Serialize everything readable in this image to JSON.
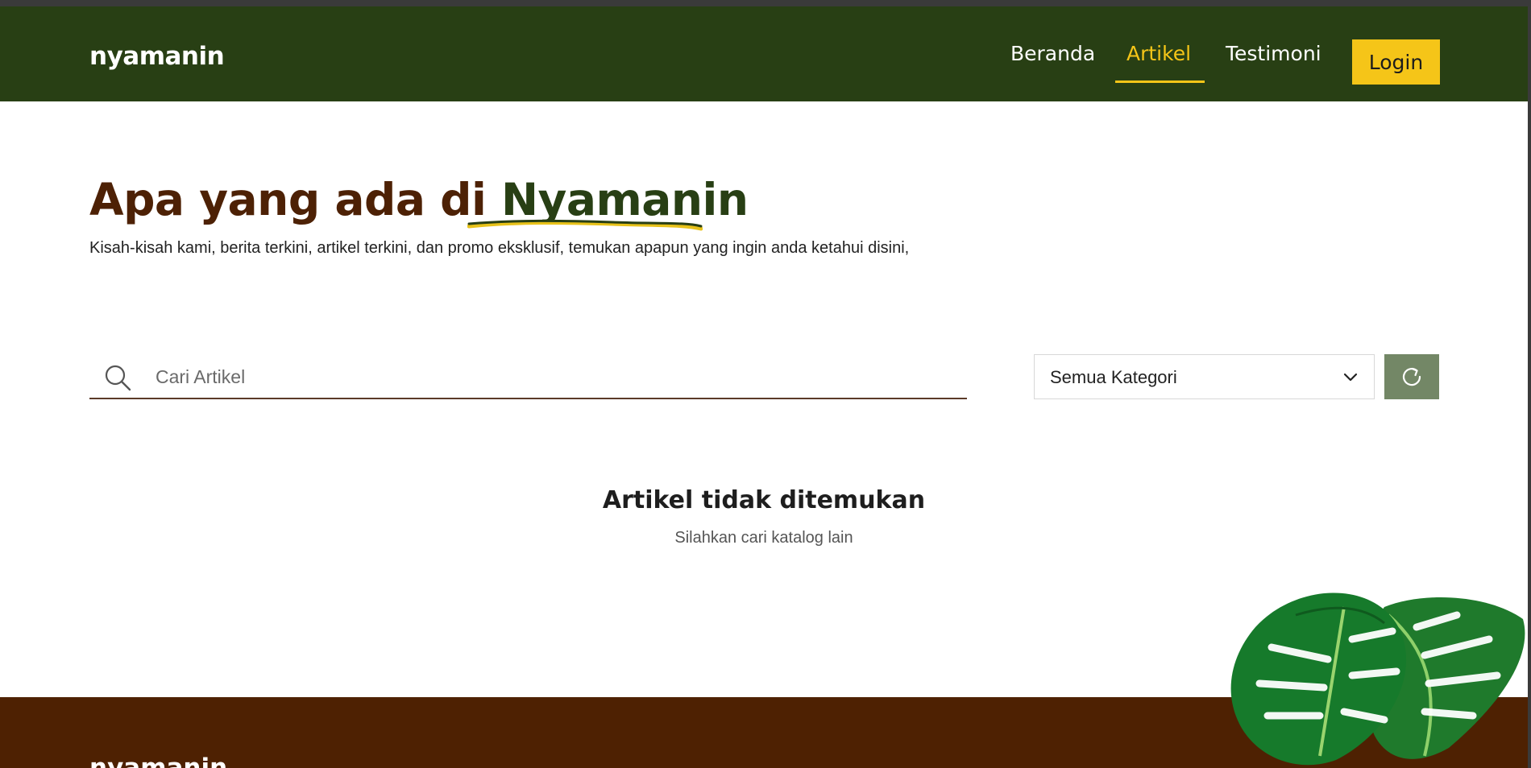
{
  "header": {
    "brand": "nyamanin",
    "nav": [
      {
        "label": "Beranda"
      },
      {
        "label": "Artikel"
      },
      {
        "label": "Testimoni"
      }
    ],
    "login_label": "Login"
  },
  "hero": {
    "title_prefix": "Apa yang ada di ",
    "title_accent": "Nyamanin",
    "subtitle": "Kisah-kisah kami, berita terkini, artikel terkini, dan promo eksklusif, temukan apapun yang ingin anda ketahui disini,"
  },
  "search": {
    "placeholder": "Cari Artikel",
    "icon": "search-icon"
  },
  "filter": {
    "selected": "Semua Kategori",
    "icon": "chevron-down-icon"
  },
  "refresh": {
    "icon": "refresh-icon"
  },
  "empty_state": {
    "title": "Artikel tidak ditemukan",
    "subtitle": "Silahkan cari katalog lain"
  },
  "footer": {
    "brand": "nyamanin"
  },
  "colors": {
    "nav_bg": "#283f14",
    "accent_yellow": "#f5c518",
    "title_brown": "#4d2105",
    "footer_brown": "#4e2102",
    "refresh_green": "#738766"
  }
}
